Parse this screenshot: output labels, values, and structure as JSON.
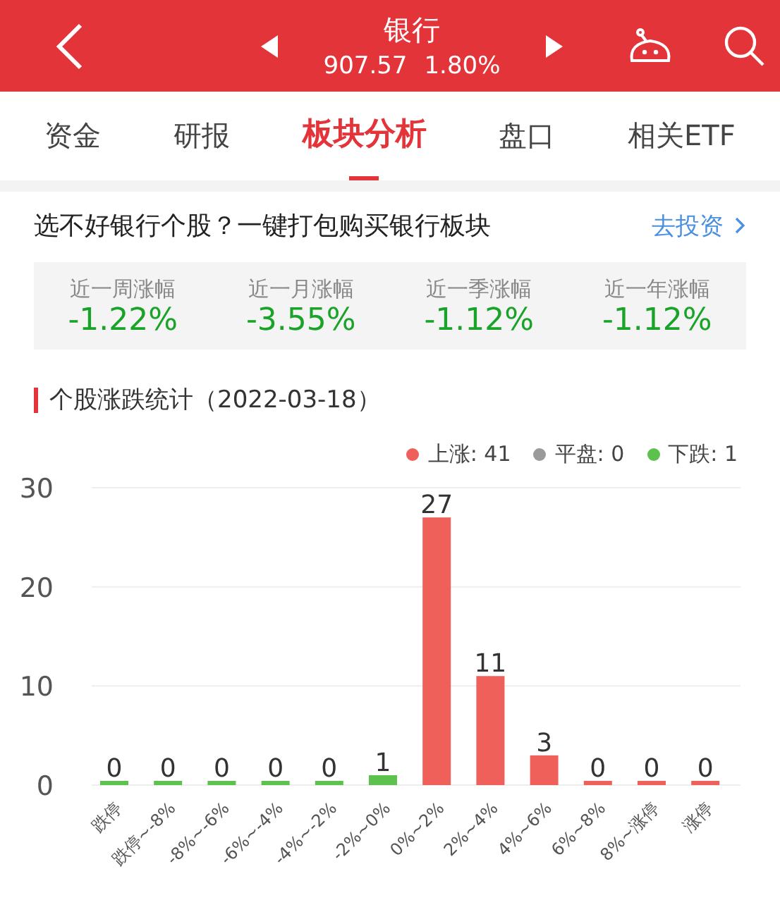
{
  "header": {
    "title": "银行",
    "price": "907.57",
    "change": "1.80%"
  },
  "tabs": [
    {
      "label": "资金",
      "selected": false
    },
    {
      "label": "研报",
      "selected": false
    },
    {
      "label": "板块分析",
      "selected": true
    },
    {
      "label": "盘口",
      "selected": false
    },
    {
      "label": "相关ETF",
      "selected": false
    }
  ],
  "promo": {
    "text": "选不好银行个股？一键打包购买银行板块",
    "link": "去投资"
  },
  "stats": [
    {
      "label": "近一周涨幅",
      "value": "-1.22%"
    },
    {
      "label": "近一月涨幅",
      "value": "-3.55%"
    },
    {
      "label": "近一季涨幅",
      "value": "-1.12%"
    },
    {
      "label": "近一年涨幅",
      "value": "-1.12%"
    }
  ],
  "section_title": "个股涨跌统计（2022-03-18）",
  "legend": [
    {
      "label": "上涨: 41",
      "color": "#f0605a"
    },
    {
      "label": "平盘: 0",
      "color": "#9a9a9a"
    },
    {
      "label": "下跌: 1",
      "color": "#5cc14d"
    }
  ],
  "chart_data": {
    "type": "bar",
    "categories": [
      "跌停",
      "跌停~-8%",
      "-8%~-6%",
      "-6%~-4%",
      "-4%~-2%",
      "-2%~0%",
      "0%~2%",
      "2%~4%",
      "4%~6%",
      "6%~8%",
      "8%~涨停",
      "涨停"
    ],
    "series": [
      {
        "color": "#5cc14d",
        "values": [
          0,
          0,
          0,
          0,
          0,
          1,
          null,
          null,
          null,
          null,
          null,
          null
        ]
      },
      {
        "color": "#f0605a",
        "values": [
          null,
          null,
          null,
          null,
          null,
          null,
          27,
          11,
          3,
          0,
          0,
          0
        ]
      }
    ],
    "stacked": true,
    "ylim": [
      0,
      30
    ],
    "yticks": [
      0,
      10,
      20,
      30
    ],
    "data_labels": true
  }
}
